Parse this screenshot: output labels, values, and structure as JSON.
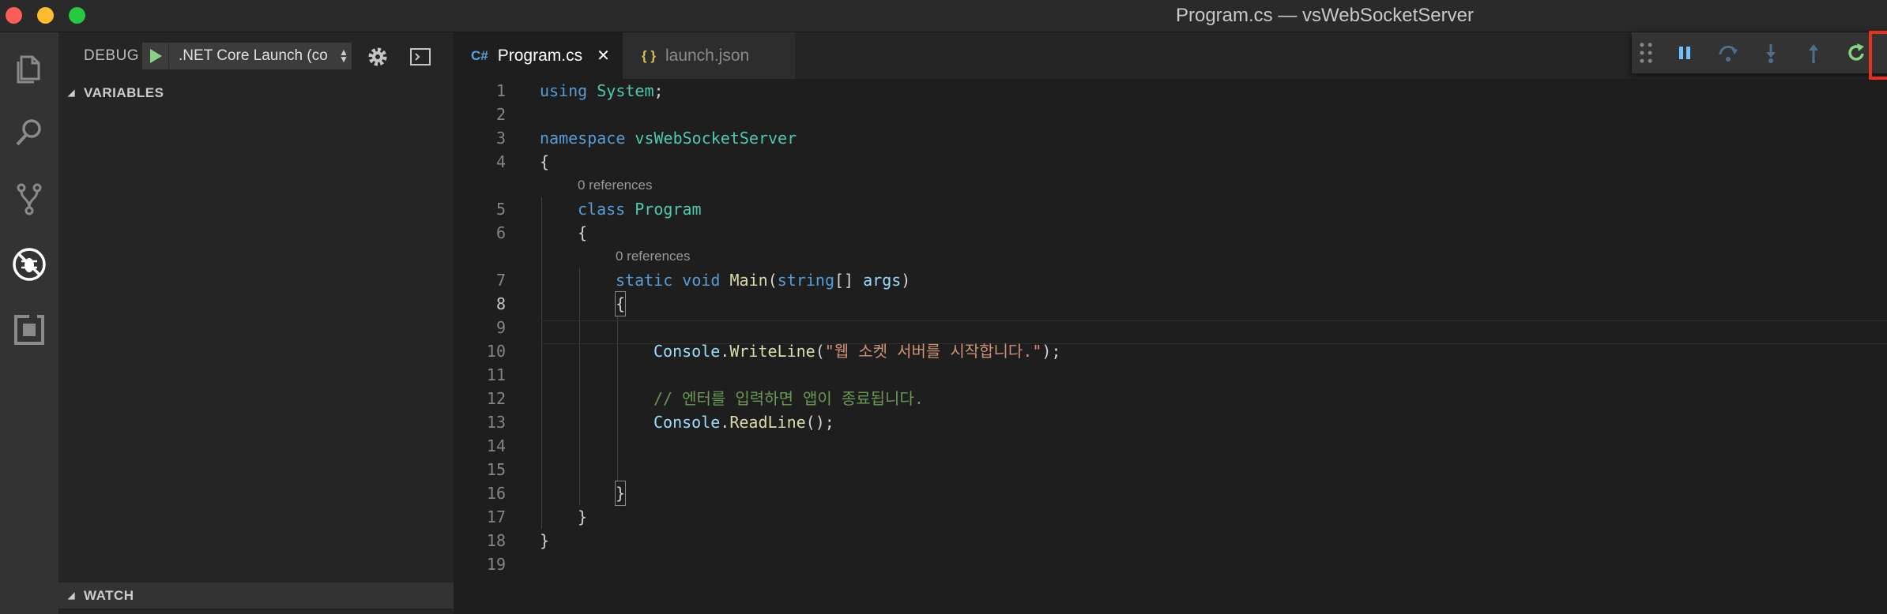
{
  "window": {
    "title": "Program.cs — vsWebSocketServer"
  },
  "activity_bar": {
    "items": [
      "explorer-icon",
      "search-icon",
      "source-control-icon",
      "debug-icon",
      "extensions-icon"
    ],
    "active": "debug-icon"
  },
  "sidebar": {
    "debug_label": "DEBUG",
    "config_value": ".NET Core Launch (co",
    "sections": {
      "variables": "VARIABLES",
      "watch": "WATCH"
    }
  },
  "tabs": [
    {
      "label": "Program.cs",
      "icon": "C#",
      "active": true,
      "close": "✕"
    },
    {
      "label": "launch.json",
      "icon": "{ }",
      "active": false
    }
  ],
  "debug_toolbar": {
    "buttons": [
      "drag-handle-icon",
      "pause-icon",
      "step-over-icon",
      "step-into-icon",
      "step-out-icon",
      "restart-icon",
      "stop-icon"
    ],
    "highlighted": "stop-icon",
    "highlight_color": "#e8311c"
  },
  "code": {
    "current_line": 8,
    "lines": [
      {
        "n": "1"
      },
      {
        "n": "2"
      },
      {
        "n": "3"
      },
      {
        "n": "4"
      },
      {
        "n": "5",
        "lens": "0 references"
      },
      {
        "n": "6"
      },
      {
        "n": "7",
        "lens": "0 references"
      },
      {
        "n": "8"
      },
      {
        "n": "9"
      },
      {
        "n": "10"
      },
      {
        "n": "11"
      },
      {
        "n": "12"
      },
      {
        "n": "13"
      },
      {
        "n": "14"
      },
      {
        "n": "15"
      },
      {
        "n": "16"
      },
      {
        "n": "17"
      },
      {
        "n": "18"
      },
      {
        "n": "19"
      }
    ],
    "text": {
      "l1_using": "using",
      "l1_system": "System",
      "l1_semi": ";",
      "l3_namespace": "namespace",
      "l3_name": "vsWebSocketServer",
      "l4": "{",
      "lens5": "0 references",
      "l5_class": "class",
      "l5_name": "Program",
      "l6": "{",
      "lens7": "0 references",
      "l7_static": "static",
      "l7_void": "void",
      "l7_main": "Main",
      "l7_open": "(",
      "l7_string": "string",
      "l7_arr": "[] ",
      "l7_args": "args",
      "l7_close": ")",
      "l8": "{",
      "l10_console": "Console",
      "l10_dot": ".",
      "l10_writeline": "WriteLine",
      "l10_open": "(",
      "l10_str": "\"웹 소켓 서버를 시작합니다.\"",
      "l10_close": ");",
      "l12_comment": "// 엔터를 입력하면 앱이 종료됩니다.",
      "l13_console": "Console",
      "l13_dot": ".",
      "l13_readline": "ReadLine",
      "l13_close": "();",
      "l16": "}",
      "l17": "}",
      "l18": "}"
    }
  }
}
